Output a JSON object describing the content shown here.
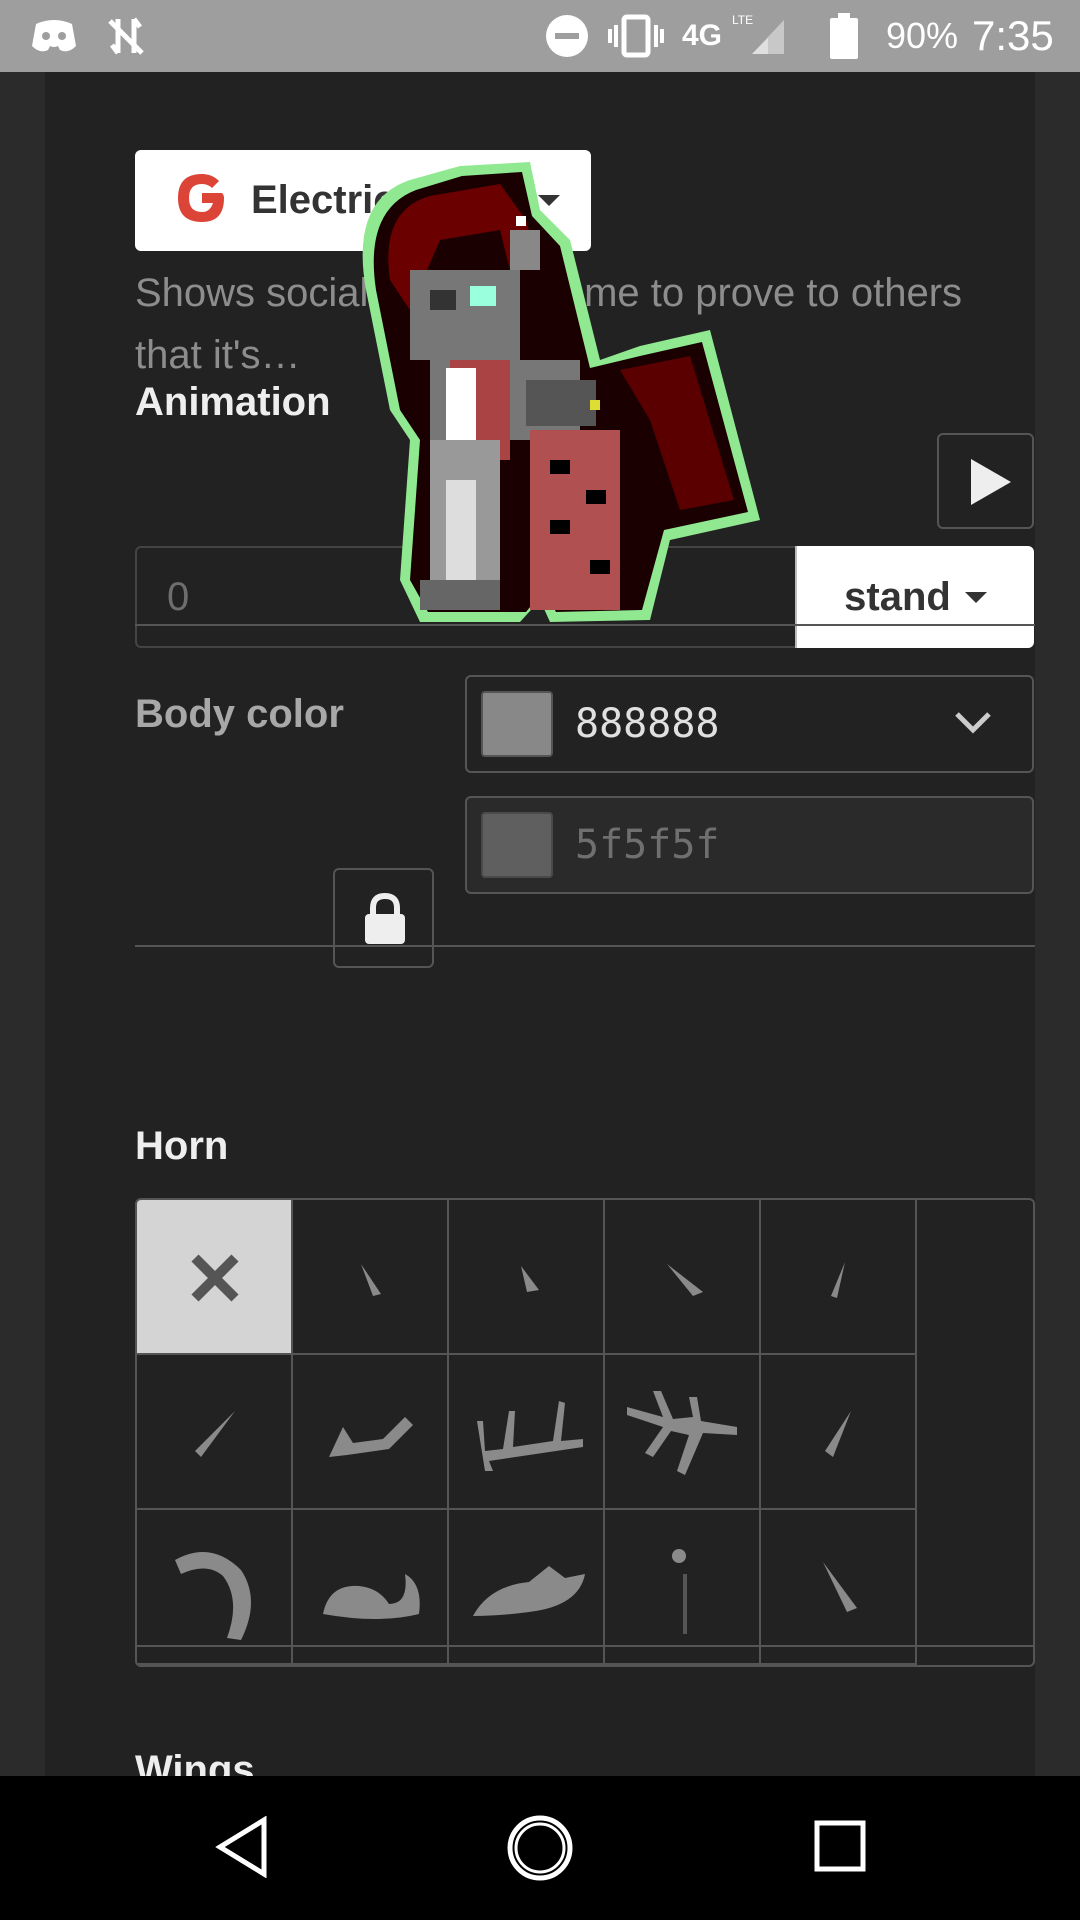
{
  "status_bar": {
    "network": "4G",
    "network_sub": "LTE",
    "battery": "90%",
    "time": "7:35"
  },
  "social": {
    "button_label": "Electric Guitar",
    "description": "Shows social s… your name to prove to others that it's…"
  },
  "animation": {
    "label": "Animation",
    "frame_placeholder": "0",
    "state_label": "stand"
  },
  "body_color": {
    "label": "Body color",
    "primary_hex": "888888",
    "primary_color": "#888888",
    "secondary_hex": "5f5f5f",
    "secondary_color": "#5f5f5f"
  },
  "horn": {
    "label": "Horn",
    "options": [
      "none",
      "horn-1",
      "horn-2",
      "horn-3",
      "horn-4",
      "horn-5",
      "antler-1",
      "antler-2",
      "antler-3",
      "horn-6",
      "curved-horn",
      "swept-horn-1",
      "swept-horn-2",
      "thin-horn",
      "horn-7"
    ]
  },
  "wings": {
    "label": "Wings"
  }
}
